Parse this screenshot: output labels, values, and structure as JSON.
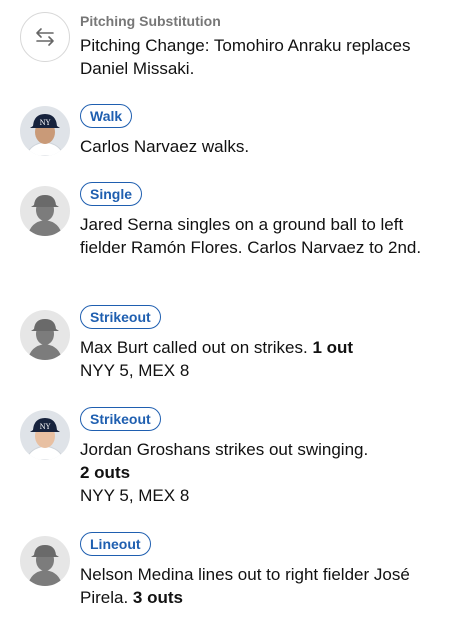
{
  "plays": [
    {
      "subhead": "Pitching Substitution",
      "description": "Pitching Change: Tomohiro Anraku replaces Daniel Missaki."
    },
    {
      "badge": "Walk",
      "description": "Carlos Narvaez walks."
    },
    {
      "badge": "Single",
      "description": "Jared Serna singles on a ground ball to left fielder Ramón Flores. Carlos Narvaez to 2nd."
    },
    {
      "badge": "Strikeout",
      "description": "Max Burt called out on strikes.",
      "outs": "1 out",
      "score": "NYY 5, MEX 8"
    },
    {
      "badge": "Strikeout",
      "description": "Jordan Groshans strikes out swinging.",
      "outs": "2 outs",
      "score": "NYY 5, MEX 8"
    },
    {
      "badge": "Lineout",
      "description": "Nelson Medina lines out to right fielder José Pirela.",
      "outs": "3 outs"
    }
  ],
  "icons": {
    "substitution": "swap-arrows-icon",
    "player_photo": "player-headshot",
    "silhouette": "player-silhouette-icon"
  },
  "colors": {
    "badge_blue": "#1f5fb0",
    "subhead_gray": "#777777",
    "silhouette_gray": "#7c7c7c"
  }
}
